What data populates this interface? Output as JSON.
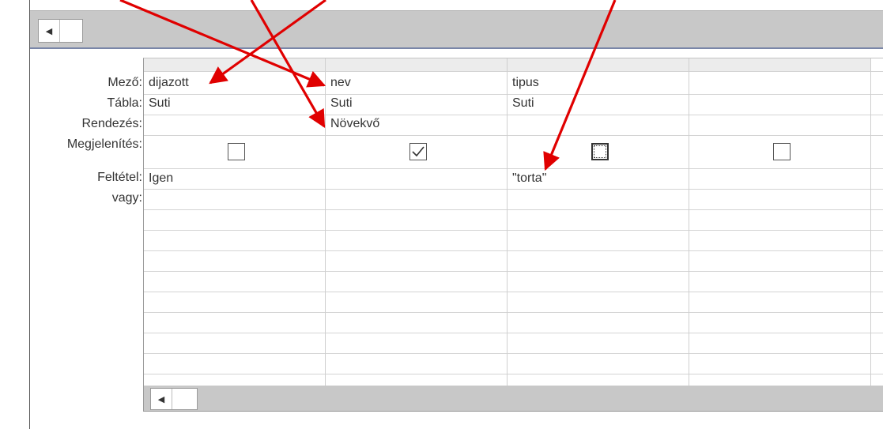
{
  "row_labels": [
    "Mező:",
    "Tábla:",
    "Rendezés:",
    "Megjelenítés:",
    "Feltétel:",
    "vagy:"
  ],
  "columns": [
    {
      "field": "dijazott",
      "table": "Suti",
      "sort": "",
      "show": false,
      "criteria": "Igen"
    },
    {
      "field": "nev",
      "table": "Suti",
      "sort": "Növekvő",
      "show": true,
      "criteria": ""
    },
    {
      "field": "tipus",
      "table": "Suti",
      "sort": "",
      "show": false,
      "criteria": "\"torta\""
    },
    {
      "field": "",
      "table": "",
      "sort": "",
      "show": false,
      "criteria": ""
    }
  ],
  "scroll_left_glyph": "◀",
  "annotation_color": "#e00000"
}
